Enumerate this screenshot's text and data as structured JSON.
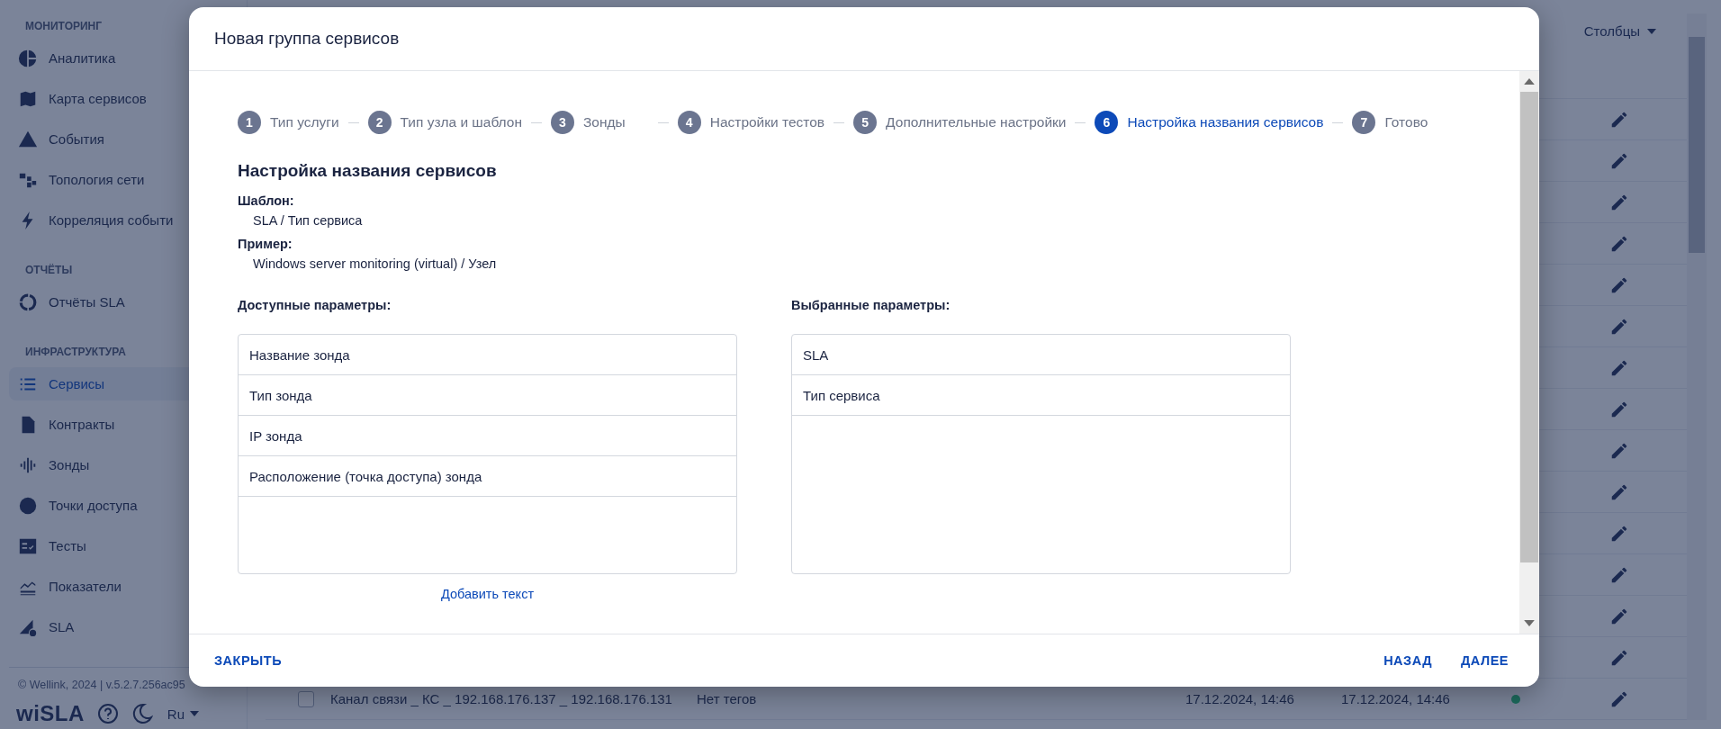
{
  "sidebar": {
    "sections": [
      {
        "title": "МОНИТОРИНГ",
        "items": [
          {
            "label": "Аналитика",
            "selected": false
          },
          {
            "label": "Карта сервисов",
            "selected": false
          },
          {
            "label": "События",
            "selected": false
          },
          {
            "label": "Топология сети",
            "selected": false
          },
          {
            "label": "Корреляция событи",
            "selected": false
          }
        ]
      },
      {
        "title": "ОТЧЁТЫ",
        "items": [
          {
            "label": "Отчёты SLA",
            "selected": false
          }
        ]
      },
      {
        "title": "ИНФРАСТРУКТУРА",
        "items": [
          {
            "label": "Сервисы",
            "selected": true
          },
          {
            "label": "Контракты",
            "selected": false
          },
          {
            "label": "Зонды",
            "selected": false
          },
          {
            "label": "Точки доступа",
            "selected": false
          },
          {
            "label": "Тесты",
            "selected": false
          },
          {
            "label": "Показатели",
            "selected": false
          },
          {
            "label": "SLA",
            "selected": false
          }
        ]
      }
    ],
    "footer": "© Wellink, 2024 | v.5.2.7.256ac95",
    "logo": "wiSLA",
    "language": "Ru"
  },
  "table": {
    "columns_button": "Столбцы",
    "rows": [
      {
        "name": "Канал связи _ КС _ 192.168.176.137 _ 192.168.176.131",
        "tags": "Нет тегов",
        "created": "17.12.2024, 14:46",
        "updated": "17.12.2024, 14:46",
        "color": "#1d6a5c",
        "checked": false
      }
    ]
  },
  "dialog": {
    "title": "Новая группа сервисов",
    "steps": [
      {
        "number": "1",
        "label": "Тип услуги",
        "selected": false
      },
      {
        "number": "2",
        "label": "Тип узла и шаблон",
        "selected": false
      },
      {
        "number": "3",
        "label": "Зонды",
        "selected": false
      },
      {
        "number": "4",
        "label": "Настройки тестов",
        "selected": false
      },
      {
        "number": "5",
        "label": "Дополнительные настройки",
        "selected": false
      },
      {
        "number": "6",
        "label": "Настройка названия сервисов",
        "selected": true
      },
      {
        "number": "7",
        "label": "Готово",
        "selected": false
      }
    ],
    "section_title": "Настройка названия сервисов",
    "fields": [
      {
        "label": "Шаблон:",
        "value": "SLA / Тип сервиса"
      },
      {
        "label": "Пример:",
        "value": "Windows server monitoring (virtual) / Узел"
      }
    ],
    "available": {
      "title": "Доступные параметры:",
      "items": [
        "Название зонда",
        "Тип зонда",
        "IP зонда",
        "Расположение (точка доступа) зонда"
      ]
    },
    "chosen": {
      "title": "Выбранные параметры:",
      "items": [
        "SLA",
        "Тип сервиса"
      ]
    },
    "add_text_link": "Добавить текст",
    "buttons": {
      "close": "ЗАКРЫТЬ",
      "back": "НАЗАД",
      "next": "ДАЛЕЕ"
    }
  }
}
